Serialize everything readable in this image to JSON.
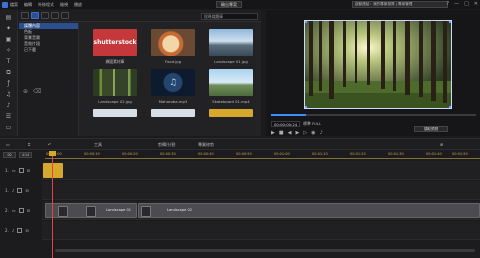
{
  "titlebar": {
    "menus": [
      "檔案",
      "編輯",
      "外掛程式",
      "檢視",
      "播放"
    ],
    "upload_label": "輸出專案",
    "notice": "啟動連結：我的專案相簿 | 專案管理",
    "window_controls": [
      "?",
      "—",
      "□",
      "✕"
    ]
  },
  "library": {
    "search_placeholder": "搜尋媒體庫",
    "categories": [
      "媒體內容",
      "色板",
      "背景音樂",
      "音效片段",
      "已下載"
    ],
    "active_category": 0,
    "tiles": [
      {
        "label": "擷圖素材庫",
        "kind": "shutterstock",
        "text": "shutterstock"
      },
      {
        "label": "Food.jpg",
        "kind": "food"
      },
      {
        "label": "Landscape 01.jpg",
        "kind": "landscape1"
      },
      {
        "label": "Landscape 02.jpg",
        "kind": "landscape2"
      },
      {
        "label": "Mahoroba.mp3",
        "kind": "audio"
      },
      {
        "label": "Skateboard 01.mp4",
        "kind": "skate"
      },
      {
        "label": "",
        "kind": "ph1"
      },
      {
        "label": "",
        "kind": "ph2"
      },
      {
        "label": "",
        "kind": "ph3"
      }
    ]
  },
  "preview": {
    "timecode": "00:00:00:24",
    "quality_label": "標準 FULL",
    "capture_label": "擷取預覽",
    "progress": 0.17
  },
  "timeline": {
    "toolbar": [
      "工具",
      "剪輯/分割",
      "專業修剪"
    ],
    "ruler_buttons": [
      "00",
      "4:14"
    ],
    "ruler_ticks": [
      "00:00:00",
      "00:00:10",
      "00:00:20",
      "00:00:30",
      "00:00:40",
      "00:00:50",
      "00:01:00",
      "00:01:10",
      "00:01:20",
      "00:01:30",
      "00:01:40",
      "00:01:50"
    ],
    "tracks": [
      {
        "id": "1.",
        "type": "video",
        "clips": [
          {
            "label": "",
            "color": "gold"
          }
        ]
      },
      {
        "id": "1.",
        "type": "audio",
        "clips": []
      },
      {
        "id": "2.",
        "type": "video",
        "clips": [
          {
            "label": "Landscape 01",
            "color": "video"
          },
          {
            "label": "Landscape 02",
            "color": "video"
          }
        ]
      },
      {
        "id": "2.",
        "type": "audio",
        "clips": []
      }
    ]
  }
}
